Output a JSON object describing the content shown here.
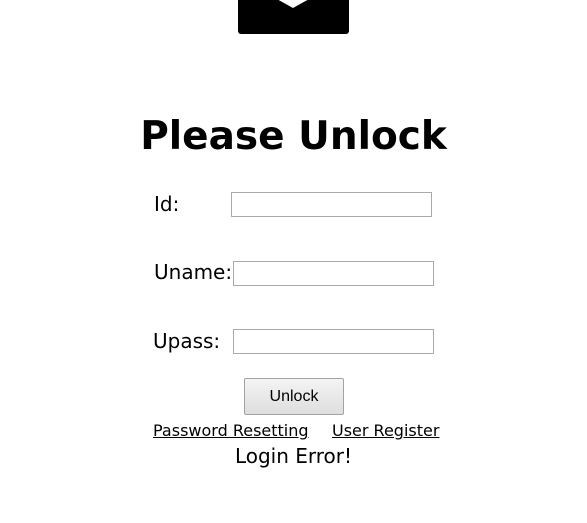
{
  "header": {
    "icon": "lock-icon",
    "title": "Please Unlock"
  },
  "form": {
    "id_label": "Id:",
    "id_value": "",
    "uname_label": "Uname:",
    "uname_value": "",
    "upass_label": "Upass:",
    "upass_value": "",
    "submit_label": "Unlock"
  },
  "links": {
    "password_reset": "Password Resetting",
    "user_register": "User Register"
  },
  "status": {
    "message": "Login Error!"
  }
}
